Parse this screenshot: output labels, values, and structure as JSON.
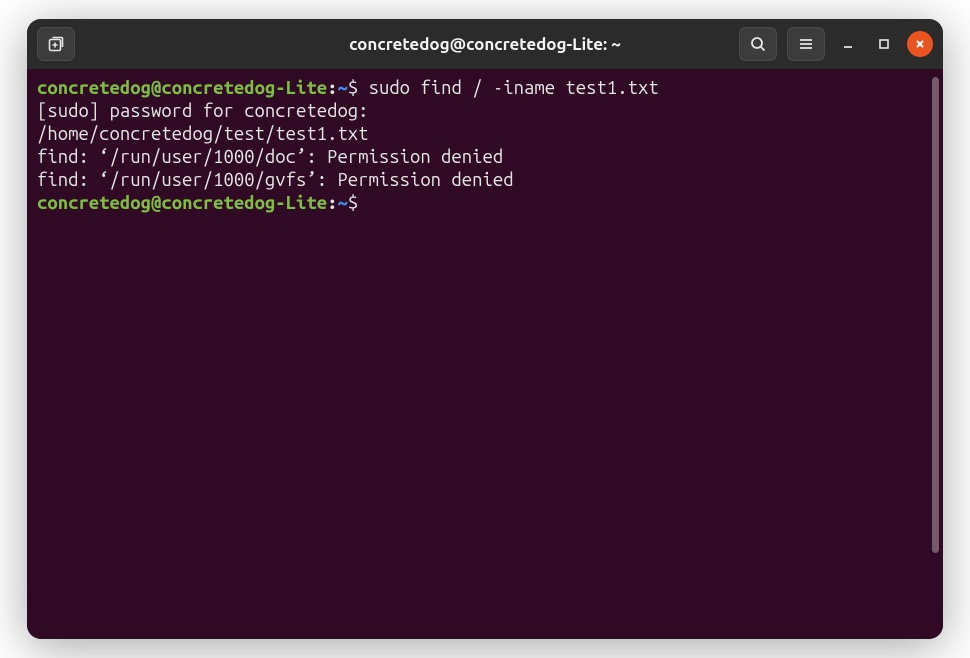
{
  "titlebar": {
    "title": "concretedog@concretedog-Lite: ~",
    "buttons": {
      "new_tab_icon": "new-tab-icon",
      "search_icon": "search-icon",
      "menu_icon": "hamburger-menu-icon",
      "minimize_icon": "minimize-icon",
      "maximize_icon": "maximize-icon",
      "close_icon": "close-icon"
    }
  },
  "prompt": {
    "user": "concretedog",
    "at": "@",
    "host": "concretedog-Lite",
    "colon": ":",
    "path": "~",
    "dollar": "$"
  },
  "terminal": {
    "lines": {
      "cmd1": " sudo find / -iname test1.txt",
      "out1": "[sudo] password for concretedog:",
      "out2": "/home/concretedog/test/test1.txt",
      "out3": "find: ‘/run/user/1000/doc’: Permission denied",
      "out4": "find: ‘/run/user/1000/gvfs’: Permission denied",
      "cmd2": " "
    }
  }
}
